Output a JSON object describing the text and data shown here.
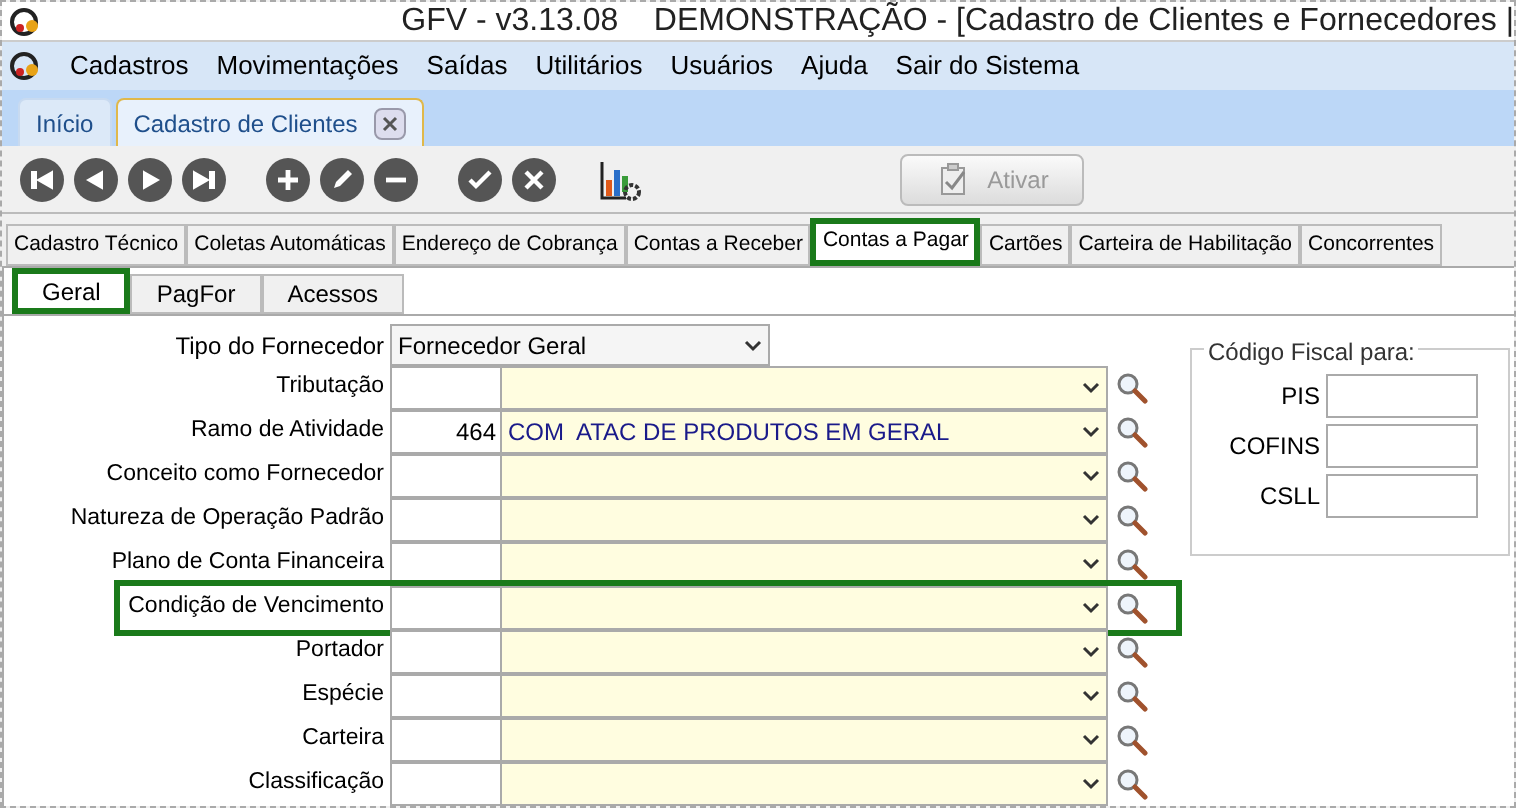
{
  "window": {
    "title": "GFV - v3.13.08    DEMONSTRAÇÃO - [Cadastro de Clientes e Fornecedores |"
  },
  "menu": [
    "Cadastros",
    "Movimentações",
    "Saídas",
    "Utilitários",
    "Usuários",
    "Ajuda",
    "Sair do Sistema"
  ],
  "doc_tabs": [
    {
      "label": "Início",
      "selected": false,
      "closable": false
    },
    {
      "label": "Cadastro de Clientes",
      "selected": true,
      "closable": true
    }
  ],
  "toolbar": {
    "activate_button": {
      "label": "Ativar",
      "disabled": true
    }
  },
  "tabs": [
    {
      "label": "Cadastro Técnico",
      "selected": false,
      "highlighted": false
    },
    {
      "label": "Coletas Automáticas",
      "selected": false,
      "highlighted": false
    },
    {
      "label": "Endereço de Cobrança",
      "selected": false,
      "highlighted": false
    },
    {
      "label": "Contas a Receber",
      "selected": false,
      "highlighted": false
    },
    {
      "label": "Contas a Pagar",
      "selected": true,
      "highlighted": true
    },
    {
      "label": "Cartões",
      "selected": false,
      "highlighted": false
    },
    {
      "label": "Carteira de Habilitação",
      "selected": false,
      "highlighted": false
    },
    {
      "label": "Concorrentes",
      "selected": false,
      "highlighted": false
    }
  ],
  "subtabs": [
    {
      "label": "Geral",
      "selected": true,
      "highlighted": true
    },
    {
      "label": "PagFor",
      "selected": false,
      "highlighted": false
    },
    {
      "label": "Acessos",
      "selected": false,
      "highlighted": false
    }
  ],
  "supplier_type": {
    "label": "Tipo do Fornecedor",
    "value": "Fornecedor Geral"
  },
  "fields": [
    {
      "label": "Tributação",
      "highlighted": false
    },
    {
      "label": "Ramo de Atividade",
      "code": "464",
      "description": "COM  ATAC DE PRODUTOS EM GERAL",
      "highlighted": false
    },
    {
      "label": "Conceito como Fornecedor",
      "highlighted": false
    },
    {
      "label": "Natureza de Operação Padrão",
      "highlighted": false
    },
    {
      "label": "Plano de Conta Financeira",
      "highlighted": false
    },
    {
      "label": "Condição de Vencimento",
      "highlighted": true
    },
    {
      "label": "Portador",
      "highlighted": false
    },
    {
      "label": "Espécie",
      "highlighted": false
    },
    {
      "label": "Carteira",
      "highlighted": false
    },
    {
      "label": "Classificação",
      "highlighted": false
    }
  ],
  "fiscal_code": {
    "title": "Código Fiscal para:",
    "fields": [
      "PIS",
      "COFINS",
      "CSLL"
    ]
  }
}
